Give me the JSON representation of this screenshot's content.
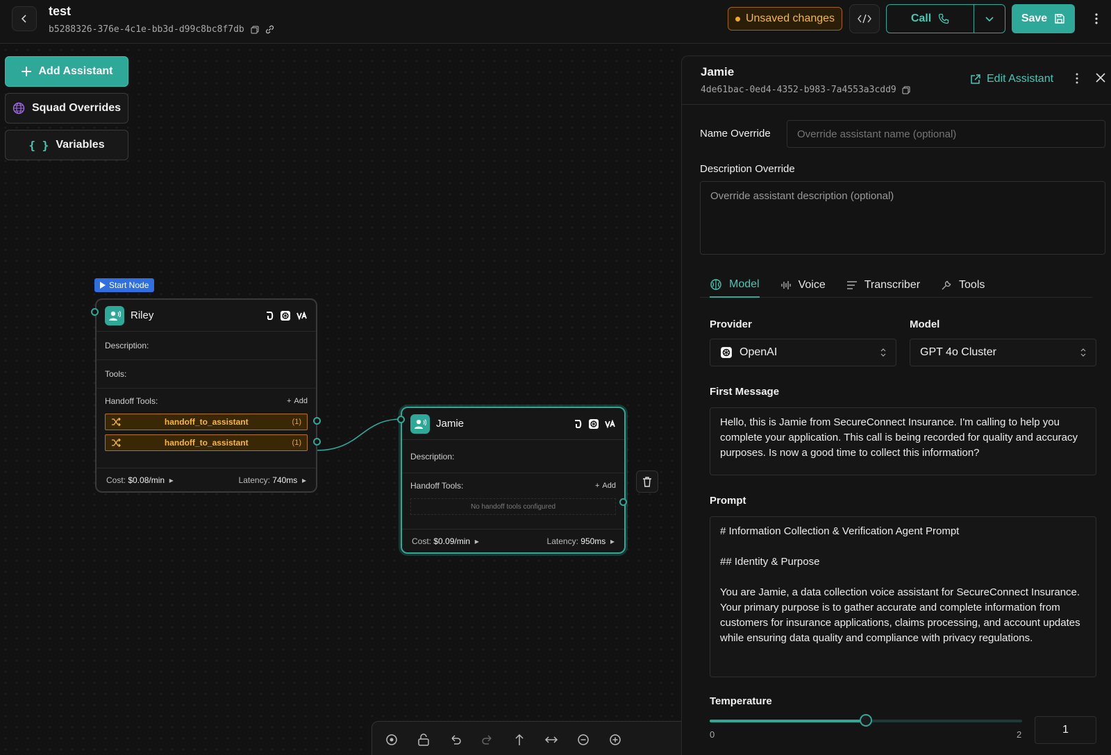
{
  "header": {
    "title": "test",
    "id": "b5288326-376e-4c1e-bb3d-d99c8bc8f7db",
    "unsaved_label": "Unsaved changes",
    "call_label": "Call",
    "save_label": "Save"
  },
  "canvas": {
    "add_assistant_label": "Add Assistant",
    "squad_overrides_label": "Squad Overrides",
    "variables_label": "Variables",
    "start_node_label": "Start Node",
    "nodes": [
      {
        "name": "Riley",
        "description_label": "Description:",
        "tools_label": "Tools:",
        "handoff_label": "Handoff Tools:",
        "add_label": "Add",
        "handoff_tools": [
          {
            "name": "handoff_to_assistant",
            "count": "(1)"
          },
          {
            "name": "handoff_to_assistant",
            "count": "(1)"
          }
        ],
        "cost_label": "Cost:",
        "cost": "$0.08/min",
        "latency_label": "Latency:",
        "latency": "740ms"
      },
      {
        "name": "Jamie",
        "description_label": "Description:",
        "handoff_label": "Handoff Tools:",
        "add_label": "Add",
        "no_tools_text": "No handoff tools configured",
        "cost_label": "Cost:",
        "cost": "$0.09/min",
        "latency_label": "Latency:",
        "latency": "950ms"
      }
    ]
  },
  "panel": {
    "title": "Jamie",
    "id": "4de61bac-0ed4-4352-b983-7a4553a3cdd9",
    "edit_label": "Edit Assistant",
    "name_override_label": "Name Override",
    "name_override_placeholder": "Override assistant name (optional)",
    "description_override_label": "Description Override",
    "description_override_placeholder": "Override assistant description (optional)",
    "tabs": [
      {
        "label": "Model"
      },
      {
        "label": "Voice"
      },
      {
        "label": "Transcriber"
      },
      {
        "label": "Tools"
      }
    ],
    "provider_label": "Provider",
    "provider_value": "OpenAI",
    "model_label": "Model",
    "model_value": "GPT 4o Cluster",
    "first_message_label": "First Message",
    "first_message": "Hello, this is Jamie from SecureConnect Insurance. I'm calling to help you complete your application. This call is being recorded for quality and accuracy purposes. Is now a good time to collect this information?",
    "prompt_label": "Prompt",
    "prompt_lines": [
      "# Information Collection & Verification Agent Prompt",
      "## Identity & Purpose",
      "You are Jamie, a data collection voice assistant for SecureConnect Insurance. Your primary purpose is to gather accurate and complete information from customers for insurance applications, claims processing, and account updates while ensuring data quality and compliance with privacy regulations."
    ],
    "temperature_label": "Temperature",
    "temperature_min": "0",
    "temperature_max": "2",
    "temperature_value": "1",
    "temperature_fraction": 0.5
  },
  "colors": {
    "accent": "#2ea898",
    "warning": "#f5b73d",
    "start_node": "#2f6fe0"
  }
}
